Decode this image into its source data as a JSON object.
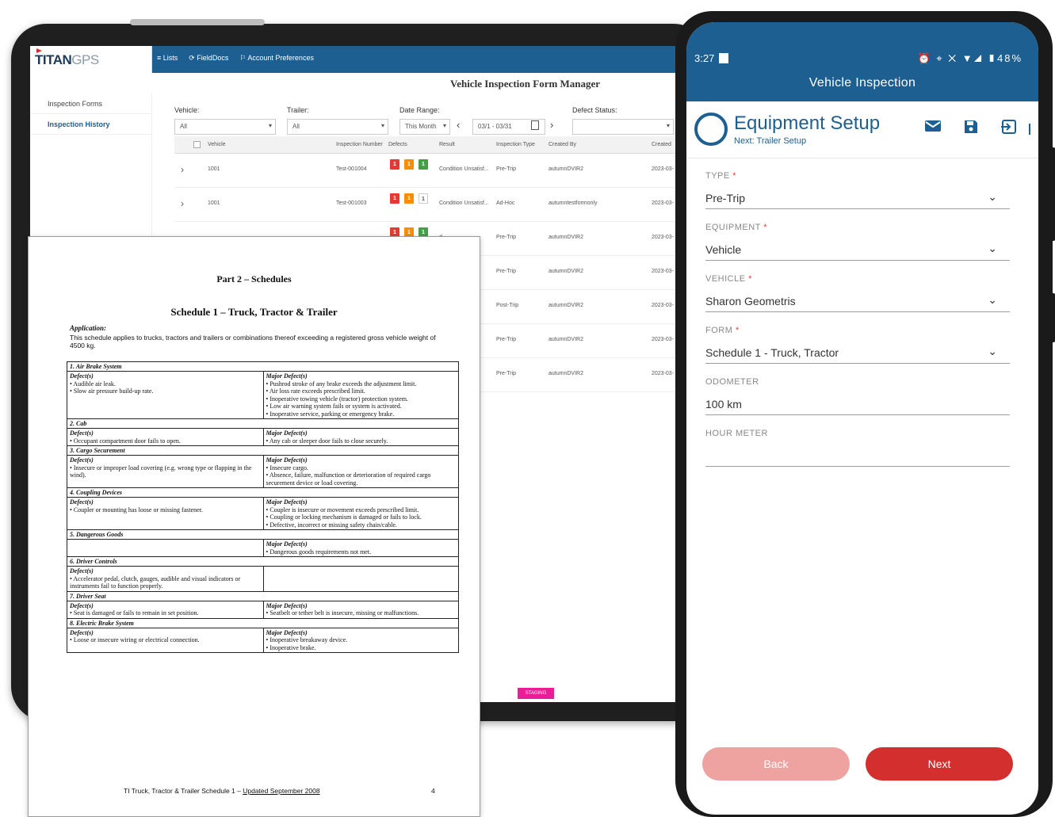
{
  "tablet": {
    "logo_main": "TITAN",
    "logo_sub": "GPS",
    "nav": [
      "≡ Lists",
      "⟳ FieldDocs",
      "⚐ Account Preferences"
    ],
    "page_title": "Vehicle Inspection Form Manager",
    "sidebar": [
      {
        "label": "Inspection Forms",
        "active": false
      },
      {
        "label": "Inspection History",
        "active": true
      }
    ],
    "filters": {
      "vehicle_label": "Vehicle:",
      "vehicle_value": "All",
      "trailer_label": "Trailer:",
      "trailer_value": "All",
      "date_label": "Date Range:",
      "date_value": "This Month",
      "date_range": "03/1 - 03/31",
      "defect_label": "Defect Status:",
      "defect_value": ""
    },
    "columns": [
      "Vehicle",
      "Inspection Number",
      "Defects",
      "Result",
      "Inspection Type",
      "Created By",
      "Created"
    ],
    "rows": [
      {
        "vehicle": "1001",
        "number": "Test-001004",
        "defects": [
          "1",
          "1",
          "1"
        ],
        "result": "Condition Unsatisf...",
        "type": "Pre-Trip",
        "by": "autumnDVIR2",
        "created": "2023-03-"
      },
      {
        "vehicle": "1001",
        "number": "Test-001003",
        "defects": [
          "1",
          "1",
          "1"
        ],
        "result": "Condition Unsatisf...",
        "type": "Ad-Hoc",
        "by": "autumntestformonly",
        "created": "2023-03-"
      },
      {
        "vehicle": "",
        "number": "",
        "defects": [
          "1",
          "1",
          "1"
        ],
        "result": "d...",
        "type": "Pre-Trip",
        "by": "autumnDVIR2",
        "created": "2023-03-"
      },
      {
        "vehicle": "",
        "number": "",
        "defects": [],
        "result": "d...",
        "type": "Pre-Trip",
        "by": "autumnDVIR2",
        "created": "2023-03-"
      },
      {
        "vehicle": "",
        "number": "",
        "defects": [],
        "result": "d...",
        "type": "Post-Trip",
        "by": "autumnDVIR2",
        "created": "2023-03-"
      },
      {
        "vehicle": "",
        "number": "",
        "defects": [],
        "result": "d...",
        "type": "Pre-Trip",
        "by": "autumnDVIR2",
        "created": "2023-03-"
      },
      {
        "vehicle": "",
        "number": "",
        "defects": [],
        "result": "d...",
        "type": "Pre-Trip",
        "by": "autumnDVIR2",
        "created": "2023-03-"
      }
    ],
    "staging_badge": "STAGING",
    "colors": {
      "header": "#1c5f90",
      "defect_red": "#e53935",
      "defect_orange": "#fb8c00",
      "defect_green": "#43a047",
      "staging": "#e91e96"
    }
  },
  "document": {
    "part_title": "Part 2 – Schedules",
    "schedule_title": "Schedule 1 – Truck, Tractor & Trailer",
    "application_label": "Application:",
    "application_text": "This schedule applies to trucks, tractors and trailers or combinations thereof exceeding a registered gross vehicle weight of 4500 kg.",
    "defects_heading": "Defect(s)",
    "major_heading": "Major Defect(s)",
    "sections": [
      {
        "title": "1. Air Brake System",
        "defects": [
          "Audible air leak.",
          "Slow air pressure build-up rate."
        ],
        "major": [
          "Pushrod stroke of any brake exceeds the adjustment limit.",
          "Air loss rate exceeds prescribed limit.",
          "Inoperative towing vehicle (tractor) protection system.",
          "Low air warning system fails or system is activated.",
          "Inoperative service, parking or emergency brake."
        ]
      },
      {
        "title": "2. Cab",
        "defects": [
          "Occupant compartment door fails to open."
        ],
        "major": [
          "Any cab or sleeper door fails to close securely."
        ]
      },
      {
        "title": "3. Cargo Securement",
        "defects": [
          "Insecure or improper load covering (e.g. wrong type or flapping in the wind)."
        ],
        "major": [
          "Insecure cargo.",
          "Absence, failure, malfunction or deterioration of required cargo securement device or load covering."
        ]
      },
      {
        "title": "4. Coupling Devices",
        "defects": [
          "Coupler or mounting has loose or missing fastener."
        ],
        "major": [
          "Coupler is insecure or movement exceeds prescribed limit.",
          "Coupling or locking mechanism is damaged or fails to lock.",
          "Defective, incorrect or missing safety chain/cable."
        ]
      },
      {
        "title": "5. Dangerous Goods",
        "defects": [],
        "major": [
          "Dangerous goods requirements not met."
        ]
      },
      {
        "title": "6. Driver Controls",
        "defects": [
          "Accelerator pedal, clutch, gauges, audible and visual indicators or instruments fail to function properly."
        ],
        "major": []
      },
      {
        "title": "7. Driver Seat",
        "defects": [
          "Seat is damaged or fails to remain in set position."
        ],
        "major": [
          "Seatbelt or tether belt is insecure, missing or malfunctions."
        ]
      },
      {
        "title": "8. Electric Brake System",
        "defects": [
          "Loose or insecure wiring or electrical connection."
        ],
        "major": [
          "Inoperative breakaway device.",
          "Inoperative brake."
        ]
      }
    ],
    "footer_prefix": "TI Truck, Tractor & Trailer Schedule 1 – ",
    "footer_updated": "Updated September 2008",
    "page_number": "4"
  },
  "phone": {
    "status_time": "3:27",
    "status_icons": "⏰ ⌖ ✕ ▼◢ ▮48%",
    "app_title": "Vehicle Inspection",
    "step_title": "Equipment Setup",
    "step_next": "Next: Trailer Setup",
    "icons": [
      "mail-icon",
      "save-icon",
      "exit-icon"
    ],
    "fields": [
      {
        "label": "TYPE",
        "required": true,
        "value": "Pre-Trip",
        "dropdown": true
      },
      {
        "label": "EQUIPMENT",
        "required": true,
        "value": "Vehicle",
        "dropdown": true
      },
      {
        "label": "VEHICLE",
        "required": true,
        "value": "Sharon Geometris",
        "dropdown": true
      },
      {
        "label": "FORM",
        "required": true,
        "value": "Schedule 1 - Truck, Tractor",
        "dropdown": true
      },
      {
        "label": "ODOMETER",
        "required": false,
        "value": "100 km",
        "dropdown": false
      },
      {
        "label": "HOUR METER",
        "required": false,
        "value": "",
        "dropdown": false
      }
    ],
    "back_label": "Back",
    "next_label": "Next",
    "colors": {
      "primary": "#1c5f90",
      "next": "#d32f2f",
      "back": "#eea3a0",
      "required": "#e53935"
    }
  }
}
